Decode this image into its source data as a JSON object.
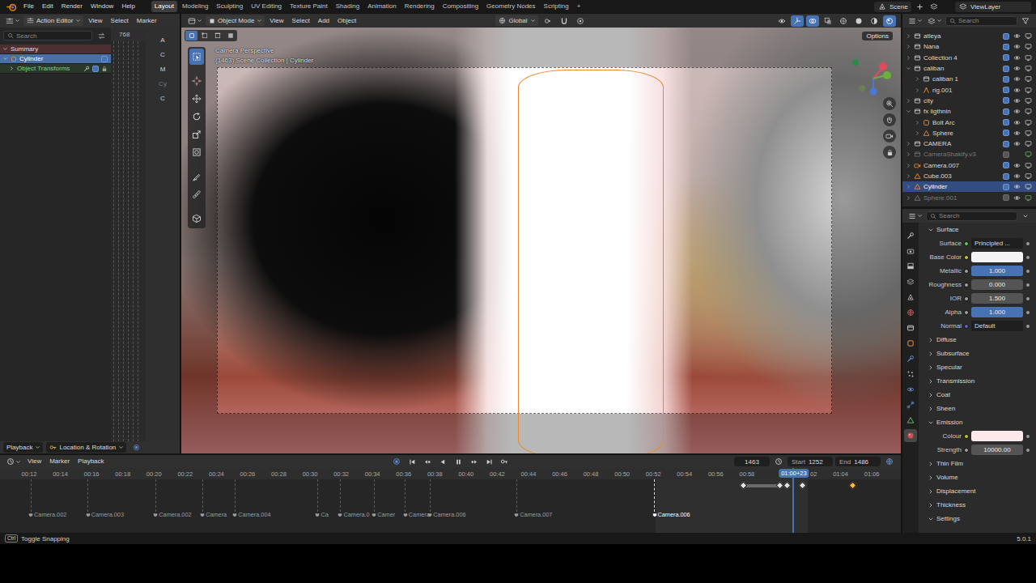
{
  "topbar": {
    "menus": [
      "File",
      "Edit",
      "Render",
      "Window",
      "Help"
    ],
    "workspaces": [
      {
        "label": "Layout",
        "selected": true
      },
      {
        "label": "Modeling",
        "selected": false
      },
      {
        "label": "Sculpting",
        "selected": false
      },
      {
        "label": "UV Editing",
        "selected": false
      },
      {
        "label": "Texture Paint",
        "selected": false
      },
      {
        "label": "Shading",
        "selected": false
      },
      {
        "label": "Animation",
        "selected": false
      },
      {
        "label": "Rendering",
        "selected": false
      },
      {
        "label": "Compositing",
        "selected": false
      },
      {
        "label": "Geometry Nodes",
        "selected": false
      },
      {
        "label": "Scripting",
        "selected": false
      }
    ],
    "add_workspace": "+",
    "scene": "Scene",
    "view_layer": "ViewLayer"
  },
  "action_editor": {
    "mode": "Action Editor",
    "menus": [
      "View",
      "Select",
      "Marker"
    ],
    "search": {
      "placeholder": "Search"
    },
    "frame": "768",
    "channels": [
      {
        "label": "Summary",
        "kind": "summary",
        "selected": false,
        "expanded": true
      },
      {
        "label": "Cylinder",
        "kind": "object",
        "selected": true,
        "expanded": true
      },
      {
        "label": "Object Transforms",
        "kind": "group",
        "selected": false,
        "expanded": false
      }
    ],
    "side_tabs": [
      {
        "label": "A",
        "disabled": false
      },
      {
        "label": "C",
        "disabled": false
      },
      {
        "label": "M",
        "disabled": false
      },
      {
        "label": "Cy",
        "disabled": true
      },
      {
        "label": "C",
        "disabled": false
      }
    ],
    "footer": {
      "playback": "Playback",
      "keying_set": "Location & Rotation"
    }
  },
  "viewport": {
    "mode": "Object Mode",
    "menus": [
      "View",
      "Select",
      "Add",
      "Object"
    ],
    "orientation": "Global",
    "options": "Options",
    "camera_label": "Camera Perspective",
    "context_label": "(1463) Scene Collection | Cylinder",
    "tools": [
      {
        "selected": true
      },
      {
        "selected": false
      },
      {
        "selected": false
      },
      {
        "selected": false
      },
      {
        "selected": false
      },
      {
        "selected": false
      },
      {
        "selected": false
      },
      {
        "selected": false
      },
      {
        "selected": false
      }
    ]
  },
  "timeline": {
    "menus": [
      "View",
      "Marker",
      "Playback"
    ],
    "current_frame": "1463",
    "start_label": "Start",
    "start": "1252",
    "end_label": "End",
    "end": "1486",
    "playhead_label": "01:00+23",
    "ruler": [
      "00:12",
      "00:14",
      "00:16",
      "00:18",
      "00:20",
      "00:22",
      "00:24",
      "00:26",
      "00:28",
      "00:30",
      "00:32",
      "00:34",
      "00:36",
      "00:38",
      "00:40",
      "00:42",
      "00:44",
      "00:46",
      "00:48",
      "00:50",
      "00:52",
      "00:54",
      "00:56",
      "00:58"
    ],
    "ruler_right": [
      "02",
      "01:04",
      "01:06"
    ],
    "keyframes": [
      {
        "frame": 1386,
        "selected": false,
        "hold": true
      },
      {
        "frame": 1443,
        "selected": false,
        "hold": false
      },
      {
        "frame": 1454,
        "selected": false,
        "hold": false
      },
      {
        "frame": 1478,
        "selected": false,
        "hold": false
      },
      {
        "frame": 1555,
        "selected": true,
        "hold": false
      }
    ],
    "markers": [
      {
        "label": "Camera.002",
        "frame": 290,
        "selected": false
      },
      {
        "label": "Camera.003",
        "frame": 378,
        "selected": false
      },
      {
        "label": "Camera.002",
        "frame": 482,
        "selected": false
      },
      {
        "label": "Camera",
        "frame": 554,
        "selected": false
      },
      {
        "label": "Camera.004",
        "frame": 604,
        "selected": false
      },
      {
        "label": "Ca",
        "frame": 731,
        "selected": false
      },
      {
        "label": "Camera.0",
        "frame": 766,
        "selected": false
      },
      {
        "label": "Camer",
        "frame": 818,
        "selected": false
      },
      {
        "label": "Camera.",
        "frame": 866,
        "selected": false
      },
      {
        "label": "Camera.006",
        "frame": 904,
        "selected": false
      },
      {
        "label": "Camera.007",
        "frame": 1037,
        "selected": false
      },
      {
        "label": "Camera.006",
        "frame": 1249,
        "selected": true
      }
    ]
  },
  "outliner": {
    "search": {
      "placeholder": "Search"
    },
    "items": [
      {
        "label": "atleya",
        "depth": 0,
        "kind": "collection",
        "expanded": false,
        "selected": false,
        "disabled": false,
        "checked": true,
        "visible": true
      },
      {
        "label": "Nana",
        "depth": 0,
        "kind": "collection",
        "expanded": false,
        "selected": false,
        "disabled": false,
        "checked": true,
        "visible": true
      },
      {
        "label": "Collection 4",
        "depth": 0,
        "kind": "collection",
        "expanded": false,
        "selected": false,
        "disabled": false,
        "checked": true,
        "visible": true
      },
      {
        "label": "caliban",
        "depth": 0,
        "kind": "collection",
        "expanded": true,
        "selected": false,
        "disabled": false,
        "checked": true,
        "visible": true
      },
      {
        "label": "caliban 1",
        "depth": 1,
        "kind": "collection",
        "expanded": false,
        "selected": false,
        "disabled": false,
        "checked": true,
        "visible": true
      },
      {
        "label": "rig.001",
        "depth": 1,
        "kind": "armature",
        "expanded": false,
        "selected": false,
        "disabled": false,
        "checked": true,
        "visible": true
      },
      {
        "label": "city",
        "depth": 0,
        "kind": "collection",
        "expanded": false,
        "selected": false,
        "disabled": false,
        "checked": true,
        "visible": true
      },
      {
        "label": "fx ligthnin",
        "depth": 0,
        "kind": "collection",
        "expanded": true,
        "selected": false,
        "disabled": false,
        "checked": true,
        "visible": true
      },
      {
        "label": "Bolt Arc",
        "depth": 1,
        "kind": "object",
        "expanded": false,
        "selected": false,
        "disabled": false,
        "checked": true,
        "visible": true
      },
      {
        "label": "Sphere",
        "depth": 1,
        "kind": "mesh",
        "expanded": false,
        "selected": false,
        "disabled": false,
        "checked": true,
        "visible": true
      },
      {
        "label": "CAMERA",
        "depth": 0,
        "kind": "collection",
        "expanded": false,
        "selected": false,
        "disabled": false,
        "checked": true,
        "visible": true
      },
      {
        "label": "CameraShakify.v3",
        "depth": 0,
        "kind": "collection",
        "expanded": false,
        "selected": false,
        "disabled": true,
        "checked": false,
        "visible": false
      },
      {
        "label": "Camera.007",
        "depth": 0,
        "kind": "camera",
        "expanded": false,
        "selected": false,
        "disabled": false,
        "checked": true,
        "visible": true
      },
      {
        "label": "Cube.003",
        "depth": 0,
        "kind": "mesh",
        "expanded": false,
        "selected": false,
        "disabled": false,
        "checked": true,
        "visible": true
      },
      {
        "label": "Cylinder",
        "depth": 0,
        "kind": "mesh",
        "expanded": false,
        "selected": true,
        "disabled": false,
        "checked": true,
        "visible": true
      },
      {
        "label": "Sphere.001",
        "depth": 0,
        "kind": "mesh",
        "expanded": false,
        "selected": false,
        "disabled": true,
        "checked": false,
        "visible": true
      }
    ]
  },
  "properties": {
    "search": {
      "placeholder": "Search"
    },
    "tabs": [
      {
        "selected": false
      },
      {
        "selected": false
      },
      {
        "selected": false
      },
      {
        "selected": false
      },
      {
        "selected": false
      },
      {
        "selected": false
      },
      {
        "selected": false
      },
      {
        "selected": false
      },
      {
        "selected": false
      },
      {
        "selected": false
      },
      {
        "selected": false
      },
      {
        "selected": false
      },
      {
        "selected": false
      },
      {
        "selected": true
      }
    ],
    "rows": [
      {
        "kind": "section",
        "label": "Surface",
        "expanded": true
      },
      {
        "kind": "dropdown",
        "label": "Surface",
        "value": "Principled ...",
        "color": "#63c763"
      },
      {
        "kind": "color",
        "label": "Base Color",
        "swatch": "#f4f4f4",
        "color": "#c7c729"
      },
      {
        "kind": "slider",
        "label": "Metallic",
        "value": "1.000",
        "level": 1,
        "color": "#a1a1a1"
      },
      {
        "kind": "slider",
        "label": "Roughness",
        "value": "0.000",
        "level": 0,
        "color": "#a1a1a1"
      },
      {
        "kind": "number",
        "label": "IOR",
        "value": "1.500",
        "color": "#a1a1a1"
      },
      {
        "kind": "slider",
        "label": "Alpha",
        "value": "1.000",
        "level": 1,
        "color": "#a1a1a1"
      },
      {
        "kind": "link",
        "label": "Normal",
        "value": "Default",
        "color": "#6363c7"
      },
      {
        "kind": "section",
        "label": "Diffuse",
        "expanded": false
      },
      {
        "kind": "section",
        "label": "Subsurface",
        "expanded": false
      },
      {
        "kind": "section",
        "label": "Specular",
        "expanded": false
      },
      {
        "kind": "section",
        "label": "Transmission",
        "expanded": false
      },
      {
        "kind": "section",
        "label": "Coat",
        "expanded": false
      },
      {
        "kind": "section",
        "label": "Sheen",
        "expanded": false
      },
      {
        "kind": "section",
        "label": "Emission",
        "expanded": true
      },
      {
        "kind": "color",
        "label": "Colour",
        "swatch": "#fde8ec",
        "color": "#c7c729"
      },
      {
        "kind": "number",
        "label": "Strength",
        "value": "10000.00",
        "color": "#a1a1a1"
      },
      {
        "kind": "section",
        "label": "Thin Film",
        "expanded": false
      },
      {
        "kind": "section",
        "label": "Volume",
        "expanded": false
      },
      {
        "kind": "section",
        "label": "Displacement",
        "expanded": false
      },
      {
        "kind": "section",
        "label": "Thickness",
        "expanded": false
      },
      {
        "kind": "section",
        "label": "Settings",
        "expanded": true
      }
    ]
  },
  "status_bar": {
    "key": "Ctrl",
    "hint": "Toggle Snapping",
    "version": "5.0.1"
  }
}
